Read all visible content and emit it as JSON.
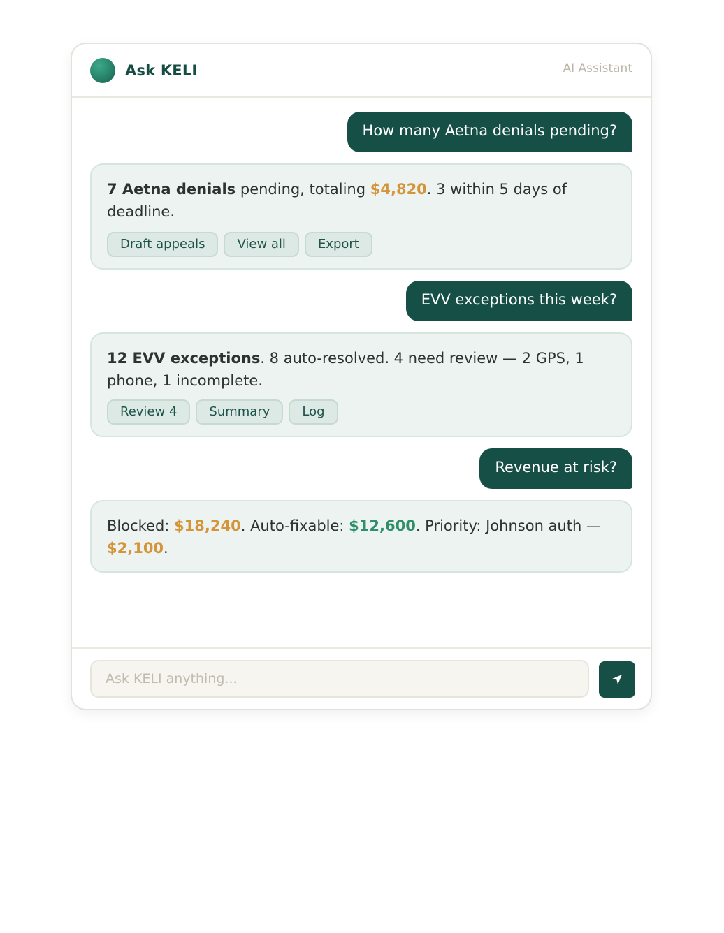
{
  "header": {
    "title": "Ask KELI",
    "subtitle": "AI Assistant"
  },
  "conversation": [
    {
      "user": "How many Aetna denials pending?",
      "bot": {
        "bold": "7 Aetna denials",
        "t1": " pending, totaling ",
        "amount": "$4,820",
        "t2": ". 3 within 5 days of deadline."
      },
      "actions": [
        "Draft appeals",
        "View all",
        "Export"
      ]
    },
    {
      "user": "EVV exceptions this week?",
      "bot": {
        "bold": "12 EVV exceptions",
        "t1": ". 8 auto-resolved. 4 need review — 2 GPS, 1 phone, 1 incomplete."
      },
      "actions": [
        "Review 4",
        "Summary",
        "Log"
      ]
    },
    {
      "user": "Revenue at risk?",
      "bot": {
        "t1": "Blocked: ",
        "blocked": "$18,240",
        "t2": ". Auto-fixable: ",
        "fixable": "$12,600",
        "t3": ". Priority: Johnson auth — ",
        "priority": "$2,100",
        "t4": "."
      }
    }
  ],
  "input": {
    "placeholder": "Ask KELI anything..."
  },
  "send_icon": "send-arrow-icon",
  "colors": {
    "primary": "#164f45",
    "warning_amount": "#d4953a",
    "positive_amount": "#2f8f6b",
    "bot_bubble": "#edf3f0"
  }
}
